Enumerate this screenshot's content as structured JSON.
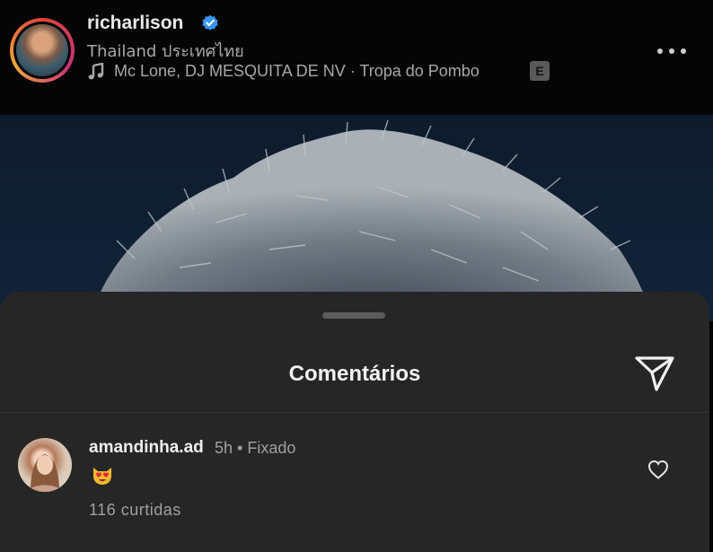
{
  "header": {
    "username": "richarlison",
    "location": "Thailand ประเทศไทย",
    "music": "Mc Lone, DJ MESQUITA DE NV · Tropa do Pombo",
    "explicit_badge": "E"
  },
  "sheet": {
    "title": "Comentários"
  },
  "comment": {
    "username": "amandinha.ad",
    "meta": "5h • Fixado",
    "emoji": "heart-eyes-cat",
    "likes": "116 curtidas"
  },
  "colors": {
    "background": "#000000",
    "sheet": "#262626",
    "verified": "#3897f0",
    "secondary_text": "#a8a8a8"
  }
}
